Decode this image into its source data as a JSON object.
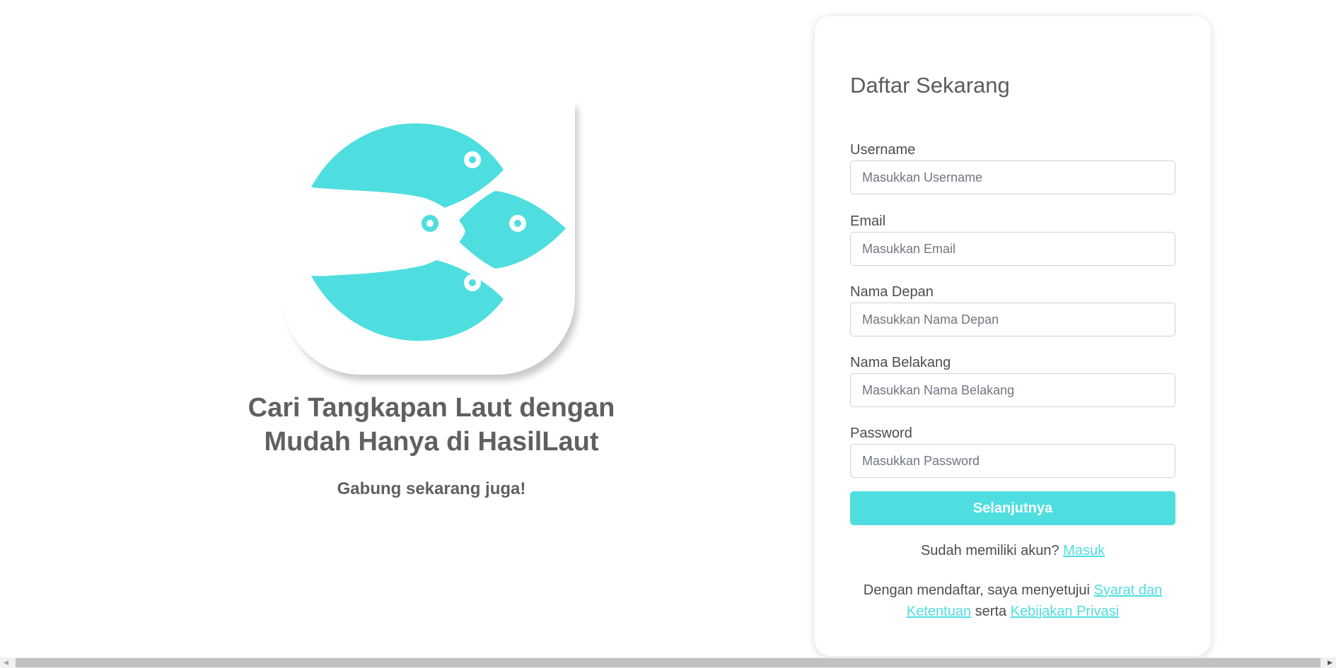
{
  "hero": {
    "logo": "hasillaut-fish-logo",
    "title_line1": "Cari Tangkapan Laut dengan",
    "title_line2": "Mudah Hanya di HasilLaut",
    "subtitle": "Gabung sekarang juga!",
    "brand_color": "#4fdedf"
  },
  "form": {
    "title": "Daftar Sekarang",
    "fields": [
      {
        "label": "Username",
        "placeholder": "Masukkan Username",
        "value": ""
      },
      {
        "label": "Email",
        "placeholder": "Masukkan Email",
        "value": ""
      },
      {
        "label": "Nama Depan",
        "placeholder": "Masukkan Nama Depan",
        "value": ""
      },
      {
        "label": "Nama Belakang",
        "placeholder": "Masukkan Nama Belakang",
        "value": ""
      },
      {
        "label": "Password",
        "placeholder": "Masukkan Password",
        "value": ""
      }
    ],
    "submit_label": "Selanjutnya",
    "login_prompt": "Sudah memiliki akun?",
    "login_link": "Masuk",
    "terms_prefix": "Dengan mendaftar, saya menyetujui",
    "terms_link": "Syarat dan Ketentuan",
    "terms_middle": "serta",
    "privacy_link": "Kebijakan Privasi",
    "accent_color": "#4fdedf"
  },
  "scrollbar": {
    "left_arrow_icon": "triangle-left",
    "right_arrow_icon": "triangle-right"
  }
}
